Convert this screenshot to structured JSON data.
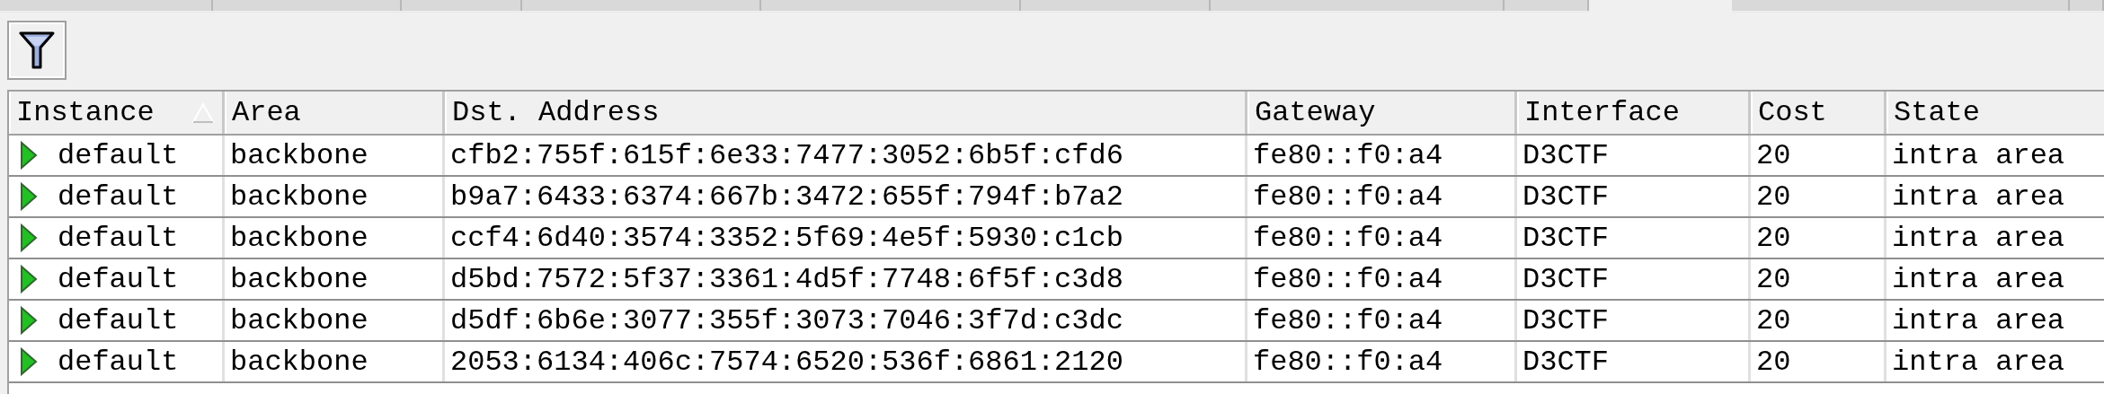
{
  "tabs": [
    {
      "selected": false
    },
    {
      "selected": false
    },
    {
      "selected": false
    },
    {
      "selected": false
    },
    {
      "selected": false
    },
    {
      "selected": false
    },
    {
      "selected": false
    },
    {
      "selected": false
    },
    {
      "selected": true
    },
    {
      "selected": false
    },
    {
      "selected": false
    }
  ],
  "table": {
    "columns": [
      {
        "label": "Instance",
        "sorted": true
      },
      {
        "label": "Area",
        "sorted": false
      },
      {
        "label": "Dst. Address",
        "sorted": false
      },
      {
        "label": "Gateway",
        "sorted": false
      },
      {
        "label": "Interface",
        "sorted": false
      },
      {
        "label": "Cost",
        "sorted": false
      },
      {
        "label": "State",
        "sorted": false
      }
    ],
    "rows": [
      [
        "default",
        "backbone",
        "cfb2:755f:615f:6e33:7477:3052:6b5f:cfd6",
        "fe80::f0:a4",
        "D3CTF",
        "20",
        "intra area"
      ],
      [
        "default",
        "backbone",
        "b9a7:6433:6374:667b:3472:655f:794f:b7a2",
        "fe80::f0:a4",
        "D3CTF",
        "20",
        "intra area"
      ],
      [
        "default",
        "backbone",
        "ccf4:6d40:3574:3352:5f69:4e5f:5930:c1cb",
        "fe80::f0:a4",
        "D3CTF",
        "20",
        "intra area"
      ],
      [
        "default",
        "backbone",
        "d5bd:7572:5f37:3361:4d5f:7748:6f5f:c3d8",
        "fe80::f0:a4",
        "D3CTF",
        "20",
        "intra area"
      ],
      [
        "default",
        "backbone",
        "d5df:6b6e:3077:355f:3073:7046:3f7d:c3dc",
        "fe80::f0:a4",
        "D3CTF",
        "20",
        "intra area"
      ],
      [
        "default",
        "backbone",
        "2053:6134:406c:7574:6520:536f:6861:2120",
        "fe80::f0:a4",
        "D3CTF",
        "20",
        "intra area"
      ]
    ]
  }
}
